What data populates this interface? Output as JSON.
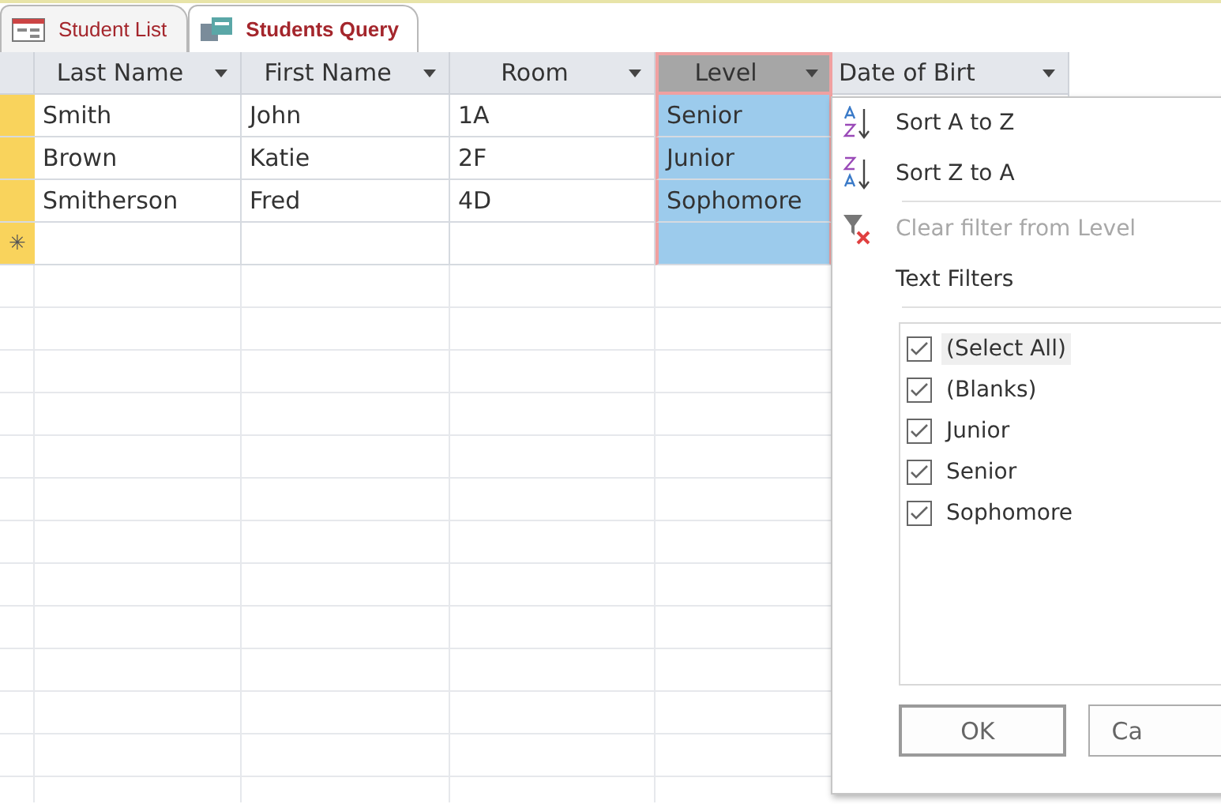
{
  "tabs": [
    {
      "label": "Student List",
      "kind": "form",
      "selected": false
    },
    {
      "label": "Students Query",
      "kind": "query",
      "selected": true
    }
  ],
  "table": {
    "columns": [
      {
        "label": "Last Name",
        "selected": false
      },
      {
        "label": "First Name",
        "selected": false
      },
      {
        "label": "Room",
        "selected": false
      },
      {
        "label": "Level",
        "selected": true
      },
      {
        "label": "Date of Birt",
        "selected": false
      }
    ],
    "rows": [
      {
        "cells": [
          "Smith",
          "John",
          "1A",
          "Senior",
          ""
        ]
      },
      {
        "cells": [
          "Brown",
          "Katie",
          "2F",
          "Junior",
          ""
        ]
      },
      {
        "cells": [
          "Smitherson",
          "Fred",
          "4D",
          "Sophomore",
          ""
        ]
      }
    ],
    "new_row_marker": "✳"
  },
  "filter_menu": {
    "items": [
      {
        "kind": "sort_az",
        "label": "Sort A to Z",
        "disabled": false
      },
      {
        "kind": "sort_za",
        "label": "Sort Z to A",
        "disabled": false
      },
      {
        "kind": "clear",
        "label": "Clear filter from Level",
        "disabled": true
      },
      {
        "kind": "text",
        "label": "Text Filters",
        "disabled": false
      }
    ],
    "values": [
      {
        "label": "(Select All)",
        "checked": true,
        "selected": true
      },
      {
        "label": "(Blanks)",
        "checked": true,
        "selected": false
      },
      {
        "label": "Junior",
        "checked": true,
        "selected": false
      },
      {
        "label": "Senior",
        "checked": true,
        "selected": false
      },
      {
        "label": "Sophomore",
        "checked": true,
        "selected": false
      }
    ],
    "buttons": [
      "OK",
      "Ca"
    ]
  }
}
